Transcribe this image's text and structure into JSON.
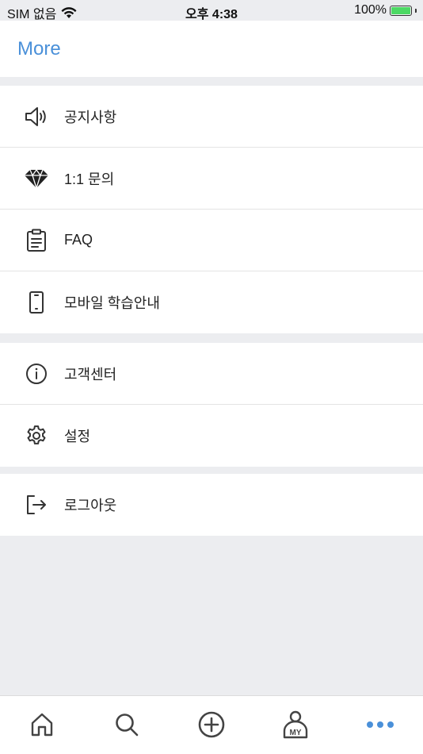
{
  "status_bar": {
    "carrier": "SIM 없음",
    "time": "오후 4:38",
    "battery": "100%",
    "icons": [
      "wifi-icon",
      "battery-charging-icon"
    ]
  },
  "header": {
    "title": "More"
  },
  "menu": {
    "group1": [
      {
        "label": "공지사항",
        "icon": "speaker-icon"
      },
      {
        "label": "1:1 문의",
        "icon": "diamond-icon"
      },
      {
        "label": "FAQ",
        "icon": "clipboard-icon"
      },
      {
        "label": "모바일 학습안내",
        "icon": "smartphone-icon"
      }
    ],
    "group2": [
      {
        "label": "고객센터",
        "icon": "info-icon"
      },
      {
        "label": "설정",
        "icon": "gear-icon"
      }
    ],
    "group3": [
      {
        "label": "로그아웃",
        "icon": "logout-icon"
      }
    ]
  },
  "tabbar": {
    "tabs": [
      {
        "name": "home",
        "icon": "home-icon"
      },
      {
        "name": "search",
        "icon": "search-icon"
      },
      {
        "name": "add",
        "icon": "add-circle-icon"
      },
      {
        "name": "my",
        "icon": "my-profile-icon",
        "label": "MY"
      },
      {
        "name": "more",
        "icon": "more-dots-icon",
        "active": true
      }
    ],
    "active_color": "#4a90d9",
    "inactive_color": "#444444"
  },
  "colors": {
    "accent": "#4a90d9",
    "background": "#ecedf0",
    "surface": "#ffffff"
  }
}
